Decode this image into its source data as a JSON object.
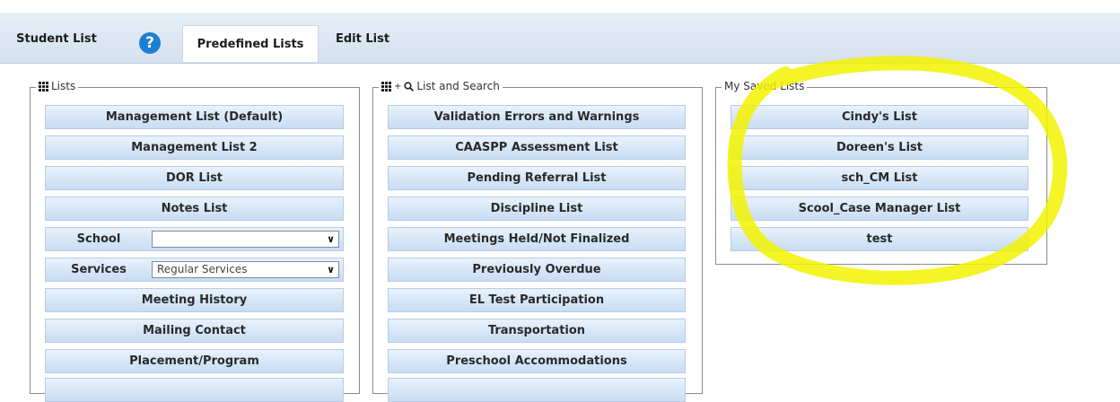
{
  "tabs": {
    "student_list": "Student List",
    "help": "?",
    "predefined": "Predefined Lists",
    "edit": "Edit List"
  },
  "lists_panel": {
    "legend": "Lists",
    "buttons": [
      "Management List (Default)",
      "Management List 2",
      "DOR List",
      "Notes List"
    ],
    "school": {
      "label": "School",
      "value": ""
    },
    "services": {
      "label": "Services",
      "value": "Regular Services"
    },
    "buttons2": [
      "Meeting History",
      "Mailing Contact",
      "Placement/Program"
    ]
  },
  "search_panel": {
    "legend": "List and Search",
    "buttons": [
      "Validation Errors and Warnings",
      "CAASPP Assessment List",
      "Pending Referral List",
      "Discipline List",
      "Meetings Held/Not Finalized",
      "Previously Overdue",
      "EL Test Participation",
      "Transportation",
      "Preschool Accommodations"
    ]
  },
  "saved_panel": {
    "legend": "My Saved Lists",
    "buttons": [
      "Cindy's List",
      "Doreen's List",
      "sch_CM List",
      "Scool_Case Manager List",
      "test"
    ]
  },
  "colors": {
    "highlight": "#f2f200",
    "help_icon": "#1e7fd0",
    "button_top": "#e9f2fc",
    "button_bottom": "#c8dcf3"
  }
}
